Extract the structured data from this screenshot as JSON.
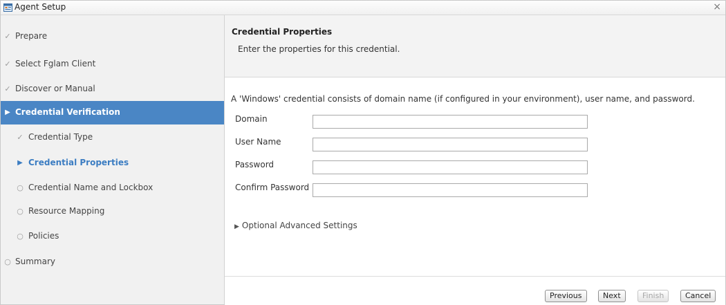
{
  "window": {
    "title": "Agent Setup",
    "close_glyph": "×"
  },
  "sidebar": {
    "steps": [
      {
        "label": "Prepare",
        "mark": "✓",
        "state": "done"
      },
      {
        "label": "Select Fglam Client",
        "mark": "✓",
        "state": "done"
      },
      {
        "label": "Discover or Manual",
        "mark": "✓",
        "state": "done"
      },
      {
        "label": "Credential Verification",
        "mark": "▶",
        "state": "active"
      },
      {
        "label": "Credential Type",
        "mark": "✓",
        "state": "done"
      },
      {
        "label": "Credential Properties",
        "mark": "▶",
        "state": "current"
      },
      {
        "label": "Credential Name and Lockbox",
        "mark": "○",
        "state": "pending"
      },
      {
        "label": "Resource Mapping",
        "mark": "○",
        "state": "pending"
      },
      {
        "label": "Policies",
        "mark": "○",
        "state": "pending"
      },
      {
        "label": "Summary",
        "mark": "○",
        "state": "pending"
      }
    ]
  },
  "panel": {
    "title": "Credential Properties",
    "subtitle": "Enter the properties for this credential.",
    "description": "A 'Windows' credential consists of domain name (if configured in your environment), user name, and password.",
    "fields": [
      {
        "label": "Domain",
        "value": ""
      },
      {
        "label": "User Name",
        "value": ""
      },
      {
        "label": "Password",
        "value": ""
      },
      {
        "label": "Confirm Password",
        "value": ""
      }
    ],
    "optional_label": "Optional Advanced Settings",
    "optional_glyph": "▶"
  },
  "footer": {
    "previous": "Previous",
    "next": "Next",
    "finish": "Finish",
    "cancel": "Cancel"
  },
  "colors": {
    "active_step_bg": "#4a86c5",
    "current_step_text": "#3c7dc2",
    "sidebar_bg": "#f1f1f1"
  }
}
